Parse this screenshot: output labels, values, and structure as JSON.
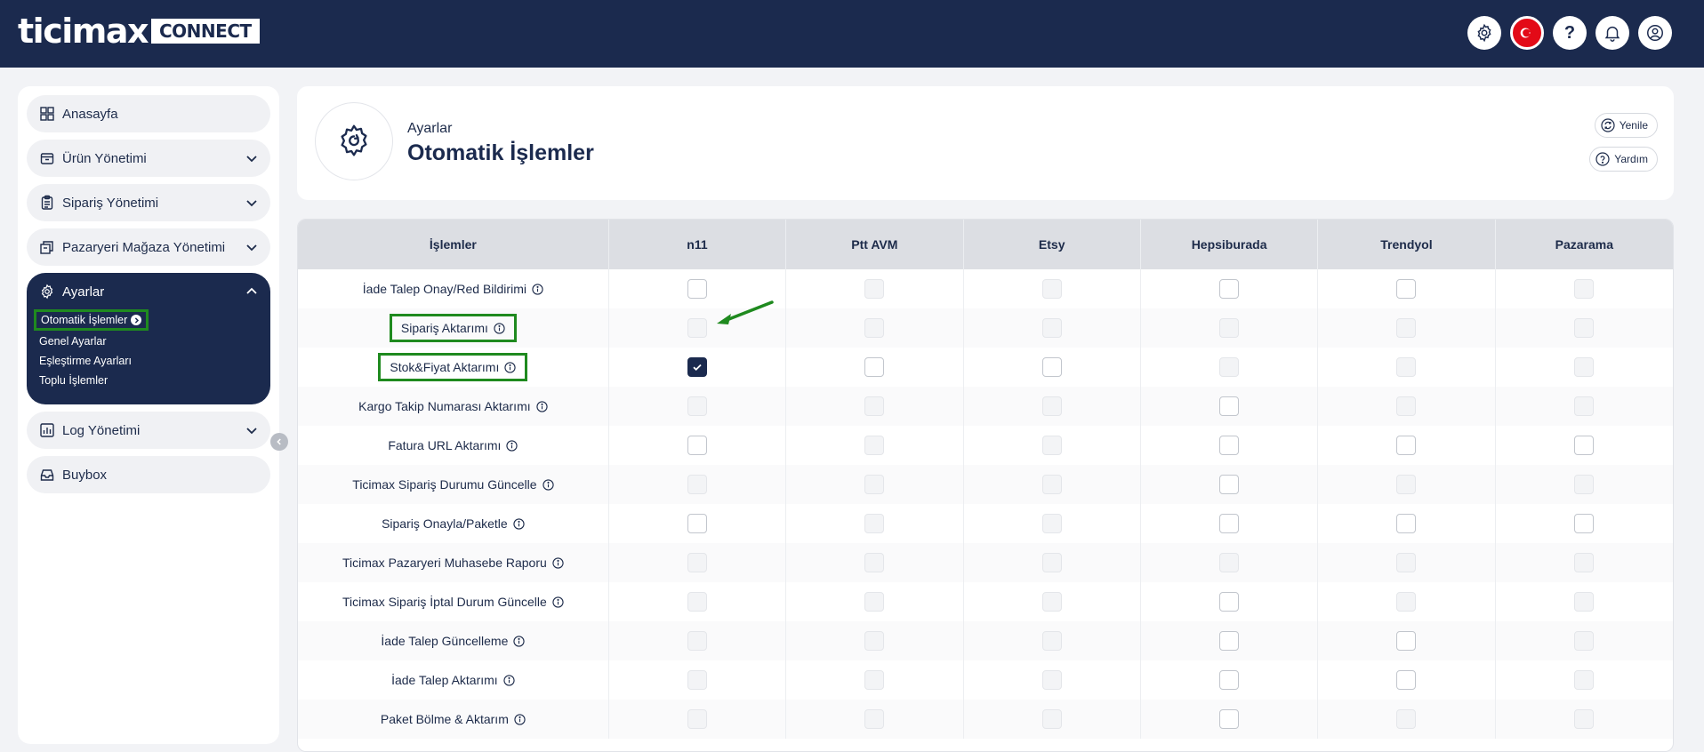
{
  "brand": {
    "logo_word": "ticimax",
    "logo_suffix": "CONNECT"
  },
  "topbar": {
    "icons": [
      "settings-icon",
      "turkey-flag-icon",
      "help-icon",
      "bell-icon",
      "user-icon"
    ],
    "help_glyph": "?"
  },
  "sidebar": {
    "items": [
      {
        "label": "Anasayfa",
        "icon": "grid-icon",
        "expandable": false
      },
      {
        "label": "Ürün Yönetimi",
        "icon": "box-icon",
        "expandable": true
      },
      {
        "label": "Sipariş Yönetimi",
        "icon": "clipboard-icon",
        "expandable": true
      },
      {
        "label": "Pazaryeri Mağaza Yönetimi",
        "icon": "store-icon",
        "expandable": true
      }
    ],
    "active_group": {
      "label": "Ayarlar",
      "icon": "gear-icon",
      "sub_items": [
        "Otomatik İşlemler",
        "Genel Ayarlar",
        "Eşleştirme Ayarları",
        "Toplu İşlemler"
      ]
    },
    "items_after": [
      {
        "label": "Log Yönetimi",
        "icon": "chart-icon",
        "expandable": true
      },
      {
        "label": "Buybox",
        "icon": "inbox-icon",
        "expandable": false
      }
    ]
  },
  "header": {
    "breadcrumb": "Ayarlar",
    "title": "Otomatik İşlemler",
    "refresh_label": "Yenile",
    "help_label": "Yardım"
  },
  "table": {
    "columns": [
      "İşlemler",
      "n11",
      "Ptt AVM",
      "Etsy",
      "Hepsiburada",
      "Trendyol",
      "Pazarama"
    ],
    "rows": [
      {
        "label": "İade Talep Onay/Red Bildirimi",
        "highlight": false,
        "cells": [
          "enabled",
          "disabled",
          "disabled",
          "enabled",
          "enabled",
          "disabled"
        ]
      },
      {
        "label": "Sipariş Aktarımı",
        "highlight": true,
        "cells": [
          "disabled",
          "disabled",
          "disabled",
          "disabled",
          "disabled",
          "disabled"
        ]
      },
      {
        "label": "Stok&Fiyat Aktarımı",
        "highlight": true,
        "cells": [
          "checked",
          "enabled",
          "enabled",
          "disabled",
          "disabled",
          "disabled"
        ]
      },
      {
        "label": "Kargo Takip Numarası Aktarımı",
        "highlight": false,
        "cells": [
          "disabled",
          "disabled",
          "disabled",
          "enabled",
          "disabled",
          "disabled"
        ]
      },
      {
        "label": "Fatura URL Aktarımı",
        "highlight": false,
        "cells": [
          "enabled",
          "disabled",
          "disabled",
          "enabled",
          "enabled",
          "enabled"
        ]
      },
      {
        "label": "Ticimax Sipariş Durumu Güncelle",
        "highlight": false,
        "cells": [
          "disabled",
          "disabled",
          "disabled",
          "enabled",
          "disabled",
          "disabled"
        ]
      },
      {
        "label": "Sipariş Onayla/Paketle",
        "highlight": false,
        "cells": [
          "enabled",
          "disabled",
          "disabled",
          "enabled",
          "enabled",
          "enabled"
        ]
      },
      {
        "label": "Ticimax Pazaryeri Muhasebe Raporu",
        "highlight": false,
        "cells": [
          "disabled",
          "disabled",
          "disabled",
          "disabled",
          "disabled",
          "disabled"
        ]
      },
      {
        "label": "Ticimax Sipariş İptal Durum Güncelle",
        "highlight": false,
        "cells": [
          "disabled",
          "disabled",
          "disabled",
          "enabled",
          "disabled",
          "disabled"
        ]
      },
      {
        "label": "İade Talep Güncelleme",
        "highlight": false,
        "cells": [
          "disabled",
          "disabled",
          "disabled",
          "enabled",
          "enabled",
          "disabled"
        ]
      },
      {
        "label": "İade Talep Aktarımı",
        "highlight": false,
        "cells": [
          "disabled",
          "disabled",
          "disabled",
          "enabled",
          "enabled",
          "disabled"
        ]
      },
      {
        "label": "Paket Bölme & Aktarım",
        "highlight": false,
        "cells": [
          "disabled",
          "disabled",
          "disabled",
          "enabled",
          "disabled",
          "disabled"
        ]
      }
    ]
  },
  "colors": {
    "navy": "#1b2a4e",
    "highlight_green": "#1f8a1f"
  }
}
